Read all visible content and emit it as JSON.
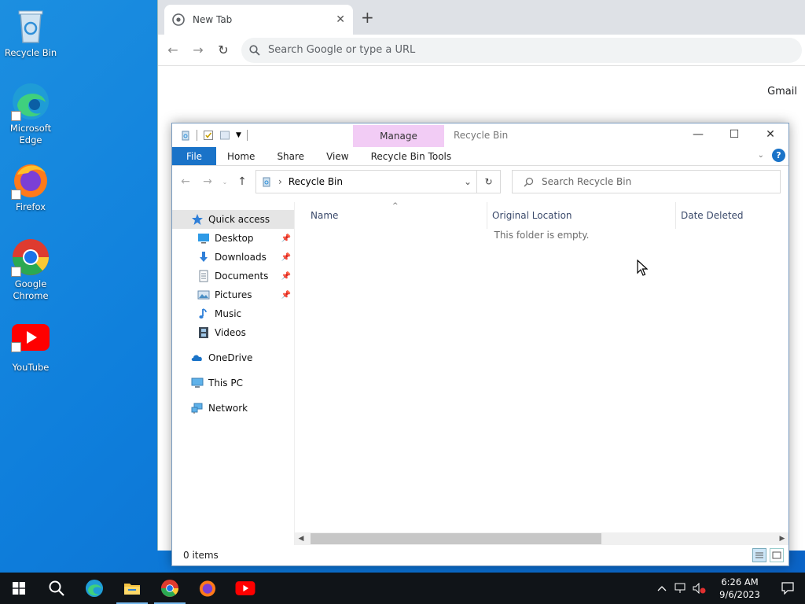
{
  "desktop": {
    "icons": [
      {
        "label": "Recycle Bin"
      },
      {
        "label": "Microsoft Edge"
      },
      {
        "label": "Firefox"
      },
      {
        "label": "Google Chrome"
      },
      {
        "label": "YouTube"
      }
    ]
  },
  "chrome": {
    "tab_title": "New Tab",
    "omnibox_placeholder": "Search Google or type a URL",
    "gmail_link": "Gmail"
  },
  "explorer": {
    "manage_tab": "Manage",
    "title": "Recycle Bin",
    "ribbon_tabs": [
      "File",
      "Home",
      "Share",
      "View"
    ],
    "contextual_tab": "Recycle Bin Tools",
    "address": "Recycle Bin",
    "search_placeholder": "Search Recycle Bin",
    "nav": {
      "quick_access": "Quick access",
      "desktop": "Desktop",
      "downloads": "Downloads",
      "documents": "Documents",
      "pictures": "Pictures",
      "music": "Music",
      "videos": "Videos",
      "onedrive": "OneDrive",
      "this_pc": "This PC",
      "network": "Network"
    },
    "columns": [
      "Name",
      "Original Location",
      "Date Deleted"
    ],
    "empty_message": "This folder is empty.",
    "status": "0 items"
  },
  "taskbar": {
    "time": "6:26 AM",
    "date": "9/6/2023"
  },
  "colors": {
    "accent": "#1a73c8",
    "manage_tab": "#f2ccf5",
    "taskbar": "#101418"
  }
}
